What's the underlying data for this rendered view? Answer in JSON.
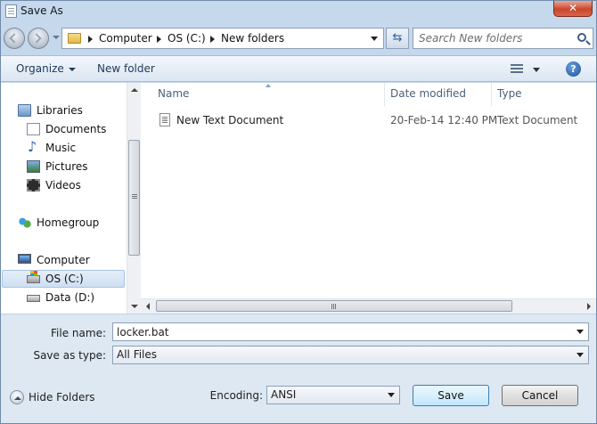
{
  "window": {
    "title": "Save As",
    "close_label": "✕"
  },
  "address_bar": {
    "crumbs": [
      "Computer",
      "OS (C:)",
      "New folders"
    ]
  },
  "search": {
    "placeholder": "Search New folders"
  },
  "toolbar": {
    "organize_label": "Organize",
    "new_folder_label": "New folder",
    "help_label": "?"
  },
  "nav_pane": {
    "items": [
      {
        "label": "Libraries",
        "icon": "libraries-icon"
      },
      {
        "label": "Documents",
        "icon": "documents-icon"
      },
      {
        "label": "Music",
        "icon": "music-icon"
      },
      {
        "label": "Pictures",
        "icon": "pictures-icon"
      },
      {
        "label": "Videos",
        "icon": "videos-icon"
      },
      {
        "label": "Homegroup",
        "icon": "homegroup-icon"
      },
      {
        "label": "Computer",
        "icon": "computer-icon"
      },
      {
        "label": "OS (C:)",
        "icon": "os-drive-icon",
        "selected": true
      },
      {
        "label": "Data (D:)",
        "icon": "data-drive-icon"
      }
    ]
  },
  "file_list": {
    "columns": [
      "Name",
      "Date modified",
      "Type"
    ],
    "rows": [
      {
        "name": "New Text Document",
        "date_modified": "20-Feb-14 12:40 PM",
        "type": "Text Document",
        "icon": "text-document-icon"
      }
    ]
  },
  "form": {
    "file_name_label": "File name:",
    "file_name_value": "locker.bat",
    "save_as_type_label": "Save as type:",
    "save_as_type_value": "All Files",
    "encoding_label": "Encoding:",
    "encoding_value": "ANSI"
  },
  "buttons": {
    "hide_folders": "Hide Folders",
    "save": "Save",
    "cancel": "Cancel"
  }
}
